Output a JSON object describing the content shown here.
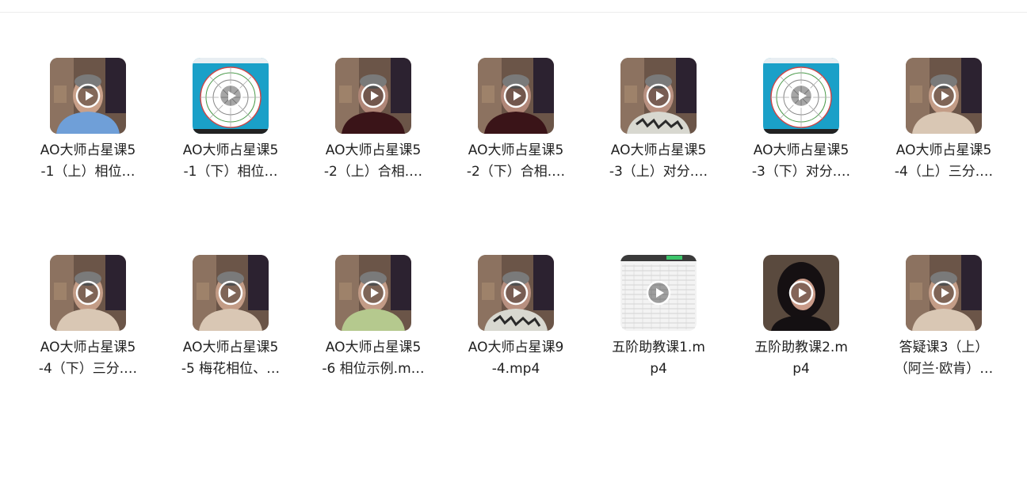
{
  "files": [
    {
      "line1": "AO大师占星课5",
      "line2": "-1（上）相位…",
      "thumb": "man-blue-shirt",
      "icon": "play-icon"
    },
    {
      "line1": "AO大师占星课5",
      "line2": "-1（下）相位…",
      "thumb": "astro-chart",
      "icon": "play-icon"
    },
    {
      "line1": "AO大师占星课5",
      "line2": "-2（上）合相.…",
      "thumb": "man-dark-shirt",
      "icon": "play-icon"
    },
    {
      "line1": "AO大师占星课5",
      "line2": "-2（下）合相.…",
      "thumb": "man-dark-shirt",
      "icon": "play-icon"
    },
    {
      "line1": "AO大师占星课5",
      "line2": "-3（上）对分.…",
      "thumb": "man-floral-shirt",
      "icon": "play-icon"
    },
    {
      "line1": "AO大师占星课5",
      "line2": "-3（下）对分.…",
      "thumb": "astro-chart",
      "icon": "play-icon"
    },
    {
      "line1": "AO大师占星课5",
      "line2": "-4（上）三分.…",
      "thumb": "man-light-shirt",
      "icon": "play-icon"
    },
    {
      "line1": "AO大师占星课5",
      "line2": "-4（下）三分.…",
      "thumb": "man-light-shirt",
      "icon": "play-icon"
    },
    {
      "line1": "AO大师占星课5",
      "line2": "-5 梅花相位、…",
      "thumb": "man-light-shirt",
      "icon": "play-icon"
    },
    {
      "line1": "AO大师占星课5",
      "line2": "-6 相位示例.m…",
      "thumb": "man-green-shirt",
      "icon": "play-icon"
    },
    {
      "line1": "AO大师占星课9",
      "line2": "-4.mp4",
      "thumb": "man-floral-shirt",
      "icon": "play-icon"
    },
    {
      "line1": "五阶助教课1.m",
      "line2": "p4",
      "thumb": "spreadsheet",
      "icon": "play-icon"
    },
    {
      "line1": "五阶助教课2.m",
      "line2": "p4",
      "thumb": "woman-dark",
      "icon": "play-icon"
    },
    {
      "line1": "答疑课3（上）",
      "line2": "（阿兰·欧肯）…",
      "thumb": "man-light-shirt",
      "icon": "play-icon"
    }
  ],
  "colors": {
    "text": "#1f1f1f",
    "room_bg": "#6b5548",
    "astro_bg": "#1aa0c8",
    "play_ring": "#ffffff"
  }
}
